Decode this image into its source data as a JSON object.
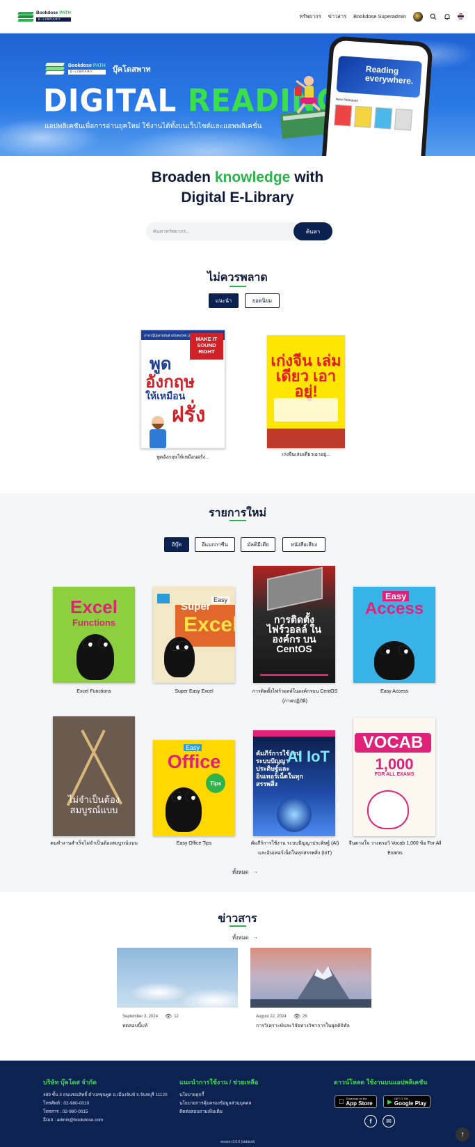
{
  "header": {
    "logo_line1": "Bookdose",
    "logo_line1_accent": "PATH",
    "logo_line2": "E-LIBRARY",
    "nav": [
      "ทรัพยากร",
      "ข่าวสาร",
      "Bookdose Superadmin"
    ],
    "icons": [
      "search-icon",
      "bell-icon",
      "thai-flag-icon"
    ]
  },
  "hero": {
    "brand_line1": "Bookdose",
    "brand_line1_accent": "PATH",
    "brand_line2": "E-LIBRARY",
    "brand_name": "บุ๊คโดสพาท",
    "title_white": "DIGITAL",
    "title_green": "READING",
    "subtitle": "แอปพลิเคชันเพื่อการอ่านยุคใหม่ ใช้งานได้ทั้งบนเว็บไซต์และแอพพลิเคชั่น",
    "phone_banner": "Reading everywhere.",
    "phone_row_label": "New Releases"
  },
  "intro": {
    "line1_a": "Broaden",
    "line1_b": "knowledge",
    "line1_c": "with",
    "line2": "Digital E-Library"
  },
  "search": {
    "placeholder": "ค้นหาทรัพยากร...",
    "button": "ค้นหา"
  },
  "featured": {
    "title": "ไม่ควรพลาด",
    "tabs": [
      {
        "label": "แนะนำ",
        "active": true
      },
      {
        "label": "ยอดนิยม",
        "active": false
      }
    ],
    "books": [
      {
        "caption": "พูดอังกฤษให้เหมือนฝรั่ง...",
        "cover_top": "ภาษาญี่ปุ่นสายมันส์ ฉบับคนไทย (Jpb)",
        "cover_badge": "MAKE IT SOUND RIGHT",
        "cover_t1": "พูด",
        "cover_t2": "อังกฤษ",
        "cover_t3": "ให้เหมือน",
        "cover_t4": "ฝรั่ง"
      },
      {
        "caption": "เก่งจีนเล่มเดียวเอาอยู่...",
        "cover_title": "เก่งจีน เล่มเดียว เอาอยู่!"
      }
    ]
  },
  "new_items": {
    "title": "รายการใหม่",
    "tabs": [
      {
        "label": "อีบุ๊ค",
        "active": true
      },
      {
        "label": "อีแมกกาซีน",
        "active": false
      },
      {
        "label": "มัลติมีเดีย",
        "active": false
      },
      {
        "label": "หนังสือเสียง",
        "active": false
      }
    ],
    "books": [
      {
        "caption": "Excel Functions",
        "cover_title": "Excel",
        "cover_sub": "Functions"
      },
      {
        "caption": "Super Easy Excel",
        "cover_t1": "Super",
        "cover_easy": "Easy",
        "cover_t2": "Excel"
      },
      {
        "caption": "การติดตั้งไฟร์วอลล์ในองค์กรบน CentOS (ภาคปฏิบัติ)",
        "cover_title": "การติดตั้ง ไฟร์วอลล์ ในองค์กร บน CentOS"
      },
      {
        "caption": "Easy Access",
        "cover_easy": "Easy",
        "cover_title": "Access"
      },
      {
        "caption": "คนทำงานสำเร็จไม่จำเป็นต้องสมบูรณ์แบบ",
        "cover_title": "ไม่จำเป็นต้อง สมบูรณ์แบบ"
      },
      {
        "caption": "Easy Office Tips",
        "cover_easy": "Easy",
        "cover_title": "Office",
        "cover_tips": "Tips"
      },
      {
        "caption": "คัมภีร์การใช้งาน ระบบปัญญาประดิษฐ์ (AI) และอินเทอร์เน็ตในทุกสรรพสิ่ง (IoT)",
        "cover_title": "คัมภีร์การใช้งาน ระบบปัญญาประดิษฐ์และ อินเทอร์เน็ตในทุกสรรพสิ่ง",
        "cover_ai": "AI IoT"
      },
      {
        "caption": "จีนตามใจ วางตรอวิ Vocab 1,000 ข้อ For All Exams",
        "cover_title": "VOCAB",
        "cover_num": "1,000",
        "cover_for": "FOR ALL EXAMS"
      }
    ],
    "view_all": "ทั้งหมด"
  },
  "news": {
    "title": "ข่าวสาร",
    "view_all": "ทั้งหมด",
    "items": [
      {
        "date": "September 3, 2024",
        "views": "12",
        "title": "ทดสอบนี้แท้"
      },
      {
        "date": "August 22, 2024",
        "views": "26",
        "title": "การวิเคราะห์และวิจัยทางวิชาการในยุคดิจิทัล"
      }
    ]
  },
  "footer": {
    "company": "บริษัท บุ๊คโดส จำกัด",
    "address": "489 ชั้น 3 ถนนรณสิทธิ์ ตำบลขุนพูด อ.เมืองจันท์ จ.จันทบุรี 11120",
    "phone": "โทรศัพท์ : 02-980-0010",
    "fax": "โทรสาร : 02-980-0015",
    "email": "อีเมล : admin@bookdose.com",
    "help_title": "แนะนำการใช้งาน / ช่วยเหลือ",
    "help_links": [
      "นโยบายคุกกี้",
      "นโยบายการคุ้มครองข้อมูลส่วนบุคคล",
      "ติดต่อสอบถามเพิ่มเติม"
    ],
    "download_title": "ดาวน์โหลด ใช้งานบนแอปพลิเคชัน",
    "app_store_small": "Download on the",
    "app_store": "App Store",
    "play_small": "GET IT ON",
    "play": "Google Play",
    "version": "version 3.0.0 (ubbtest)"
  },
  "colors": {
    "navy": "#0b2250",
    "green": "#29b34a",
    "hero_blue": "#1f63d6"
  }
}
